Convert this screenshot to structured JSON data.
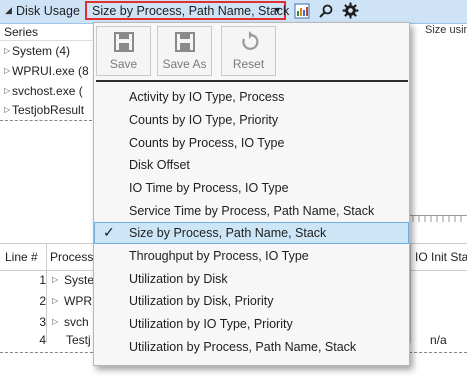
{
  "titlebar": {
    "collapse_icon": "collapse-triangle-icon",
    "title": "Disk Usage",
    "preset_selected": "Size by Process, Path Name, Stack",
    "icons": [
      "graph-icon",
      "search-icon",
      "gear-icon"
    ]
  },
  "series_panel": {
    "header": "Series",
    "right_header": "Size usin",
    "rows": [
      "System (4)",
      "WPRUI.exe (8",
      "svchost.exe (",
      "TestjobResult"
    ]
  },
  "grid": {
    "columns": [
      "Line #",
      "Process",
      "IO Init Sta"
    ],
    "rows": [
      {
        "line": "1",
        "process": "Syste",
        "expandable": true,
        "extra": ""
      },
      {
        "line": "2",
        "process": "WPR",
        "expandable": true,
        "extra": ""
      },
      {
        "line": "3",
        "process": "svch",
        "expandable": true,
        "extra": ""
      },
      {
        "line": "4",
        "process": "Testj",
        "expandable": false,
        "extra": "n/a"
      }
    ]
  },
  "popup": {
    "buttons": [
      {
        "label": "Save",
        "icon": "save-icon"
      },
      {
        "label": "Save As",
        "icon": "save-as-icon"
      },
      {
        "label": "Reset",
        "icon": "reset-icon"
      }
    ],
    "items": [
      "Activity by IO Type, Process",
      "Counts by IO Type, Priority",
      "Counts by Process, IO Type",
      "Disk Offset",
      "IO Time by Process, IO Type",
      "Service Time by Process, Path Name, Stack",
      "Size by Process, Path Name, Stack",
      "Throughput by Process, IO Type",
      "Utilization by Disk",
      "Utilization by Disk, Priority",
      "Utilization by IO Type, Priority",
      "Utilization by Process, Path Name, Stack"
    ],
    "selected_index": 6,
    "check_glyph": "✓"
  },
  "colors": {
    "titlebar_bg": "#cfe3f7",
    "highlight_border": "#e03030",
    "selected_bg": "#cde6f7"
  }
}
